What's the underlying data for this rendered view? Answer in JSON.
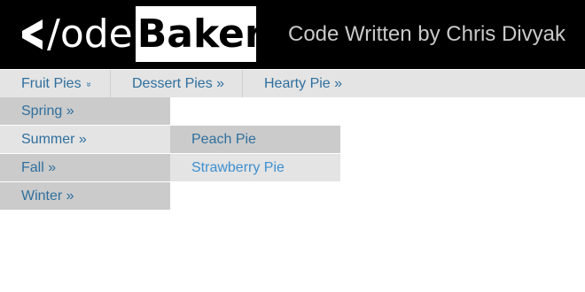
{
  "logo": {
    "light_text": "/ode",
    "bold_text": "Baker"
  },
  "header": {
    "tagline": "Code Written by Chris Divyak"
  },
  "nav": {
    "items": [
      {
        "label": "Fruit Pies",
        "indicator": "»"
      },
      {
        "label": "Dessert Pies »"
      },
      {
        "label": "Hearty Pie »"
      }
    ]
  },
  "fruit_submenu": {
    "items": [
      {
        "label": "Spring »"
      },
      {
        "label": "Summer »"
      },
      {
        "label": "Fall »"
      },
      {
        "label": "Winter »"
      }
    ]
  },
  "summer_flyout": {
    "items": [
      {
        "label": "Peach Pie"
      },
      {
        "label": "Strawberry Pie"
      }
    ]
  },
  "colors": {
    "header_bg": "#000000",
    "link": "#2f6f9e",
    "link_hover": "#3d8fd0",
    "menu_light": "#e4e4e4",
    "menu_dark": "#cbcbcb"
  }
}
